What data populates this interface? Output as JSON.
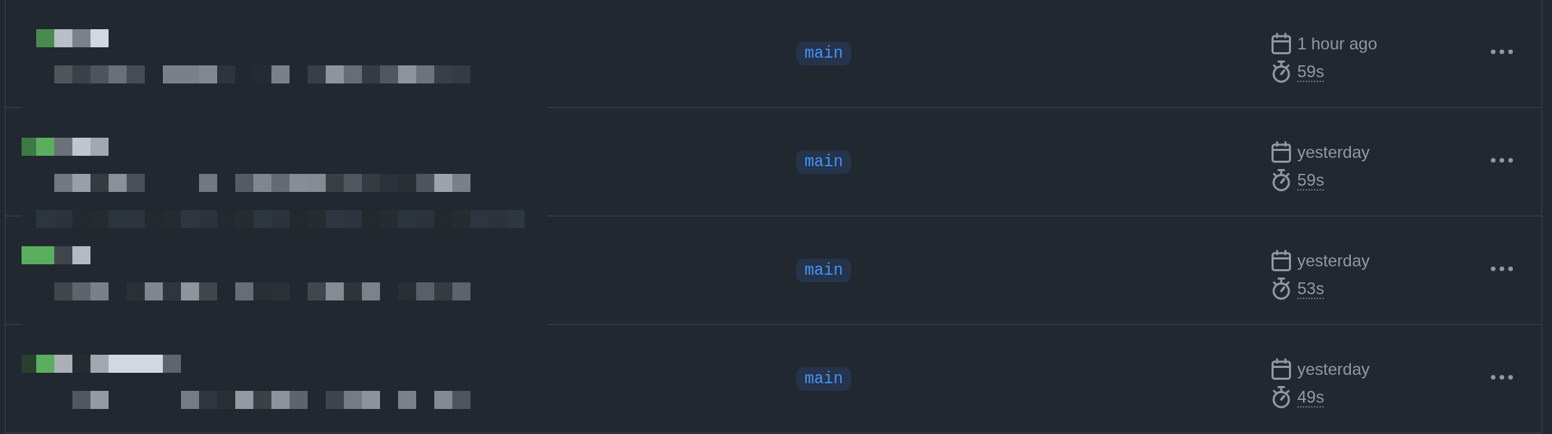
{
  "runs": [
    {
      "branch": "main",
      "started": "1 hour ago",
      "duration": "59s"
    },
    {
      "branch": "main",
      "started": "yesterday",
      "duration": "59s"
    },
    {
      "branch": "main",
      "started": "yesterday",
      "duration": "53s"
    },
    {
      "branch": "main",
      "started": "yesterday",
      "duration": "49s"
    }
  ]
}
